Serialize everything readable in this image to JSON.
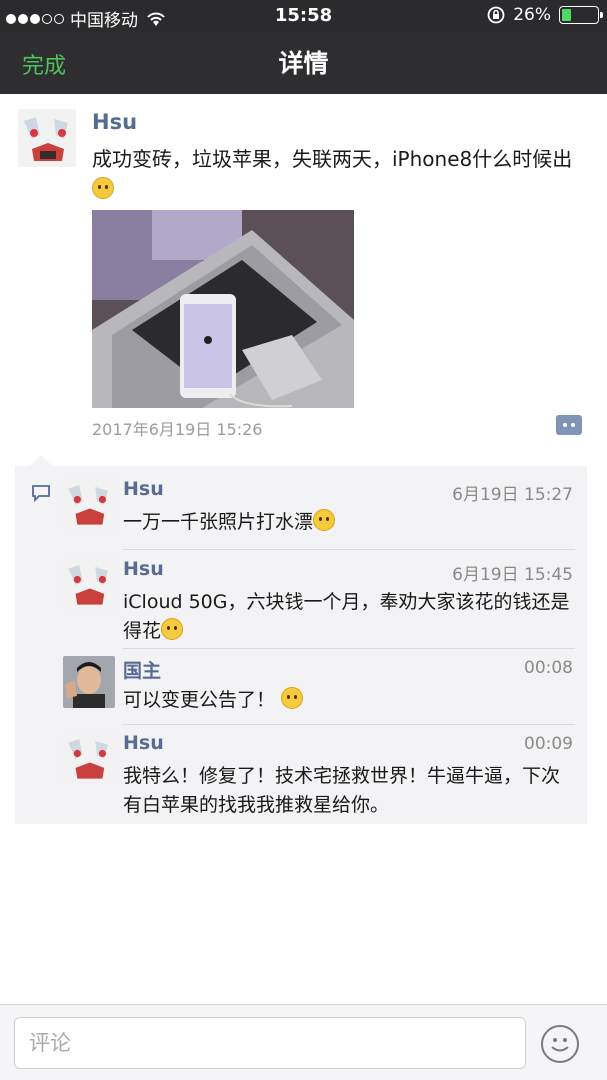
{
  "status_bar": {
    "carrier": "中国移动",
    "time": "15:58",
    "battery": "26%",
    "battery_level": 0.26,
    "accent": "#4cd964"
  },
  "nav": {
    "done_label": "完成",
    "title": "详情",
    "accent": "#4ec25a"
  },
  "post": {
    "username": "Hsu",
    "text": "成功变砖，垃圾苹果，失联两天，iPhone8什么时候出",
    "emoji": "smile-emoji",
    "photo": "laptop-with-iphone-photo",
    "date": "2017年6月19日 15:26"
  },
  "comments": [
    {
      "username": "Hsu",
      "time": "6月19日 15:27",
      "text": "一万一千张照片打水漂",
      "emoji": "smile-emoji"
    },
    {
      "username": "Hsu",
      "time": "6月19日 15:45",
      "text": "iCloud 50G，六块钱一个月，奉劝大家该花的钱还是得花",
      "emoji": "cry-emoji"
    },
    {
      "username": "国主",
      "time": "00:08",
      "text": "可以变更公告了！",
      "emoji": "grin-emoji"
    },
    {
      "username": "Hsu",
      "time": "00:09",
      "text": "我特么！修复了！技术宅拯救世界！牛逼牛逼，下次有白苹果的找我我推救星给你。"
    }
  ],
  "input": {
    "placeholder": "评论"
  },
  "colors": {
    "link_name": "#576b95",
    "nav_bg": "#2e2e30",
    "comment_bg": "#f3f3f5"
  }
}
